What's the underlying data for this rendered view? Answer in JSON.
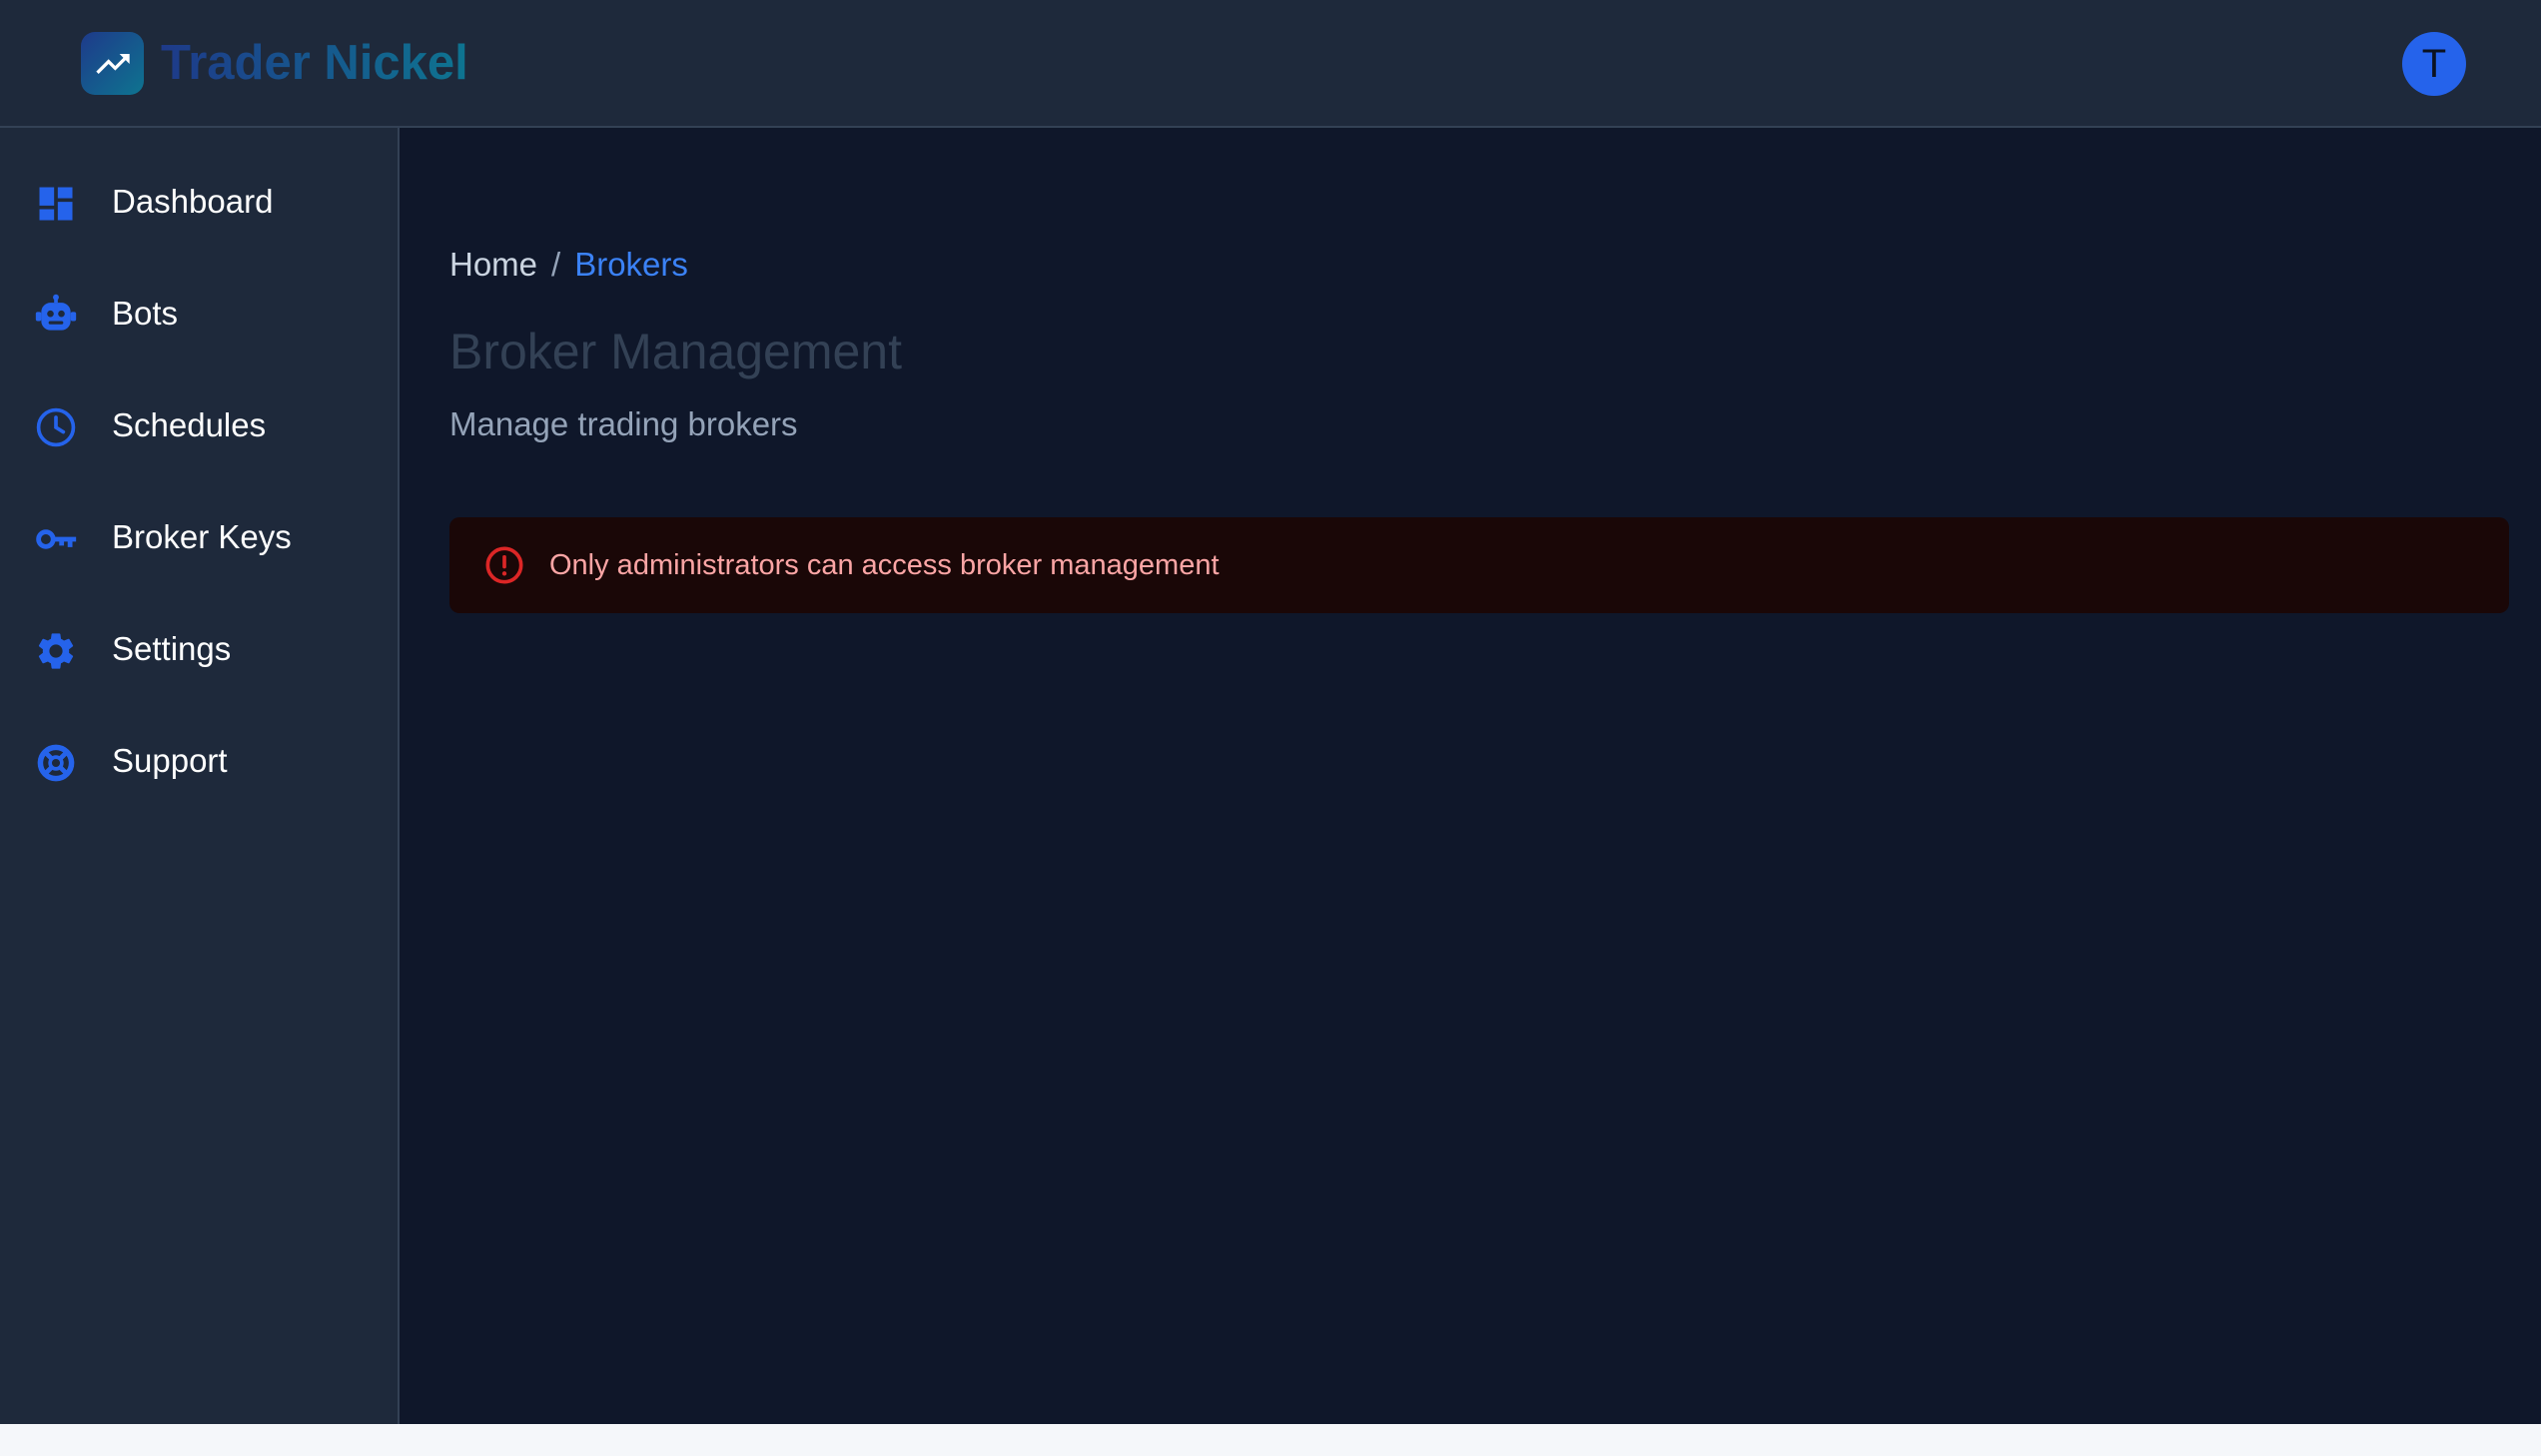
{
  "header": {
    "brand": "Trader Nickel",
    "avatar_initial": "T"
  },
  "sidebar": {
    "items": [
      {
        "label": "Dashboard",
        "icon": "dashboard-icon"
      },
      {
        "label": "Bots",
        "icon": "robot-icon"
      },
      {
        "label": "Schedules",
        "icon": "clock-icon"
      },
      {
        "label": "Broker Keys",
        "icon": "key-icon"
      },
      {
        "label": "Settings",
        "icon": "gear-icon"
      },
      {
        "label": "Support",
        "icon": "lifebuoy-icon"
      }
    ]
  },
  "breadcrumb": {
    "home": "Home",
    "separator": "/",
    "current": "Brokers"
  },
  "page": {
    "title": "Broker Management",
    "subtitle": "Manage trading brokers"
  },
  "alert": {
    "message": "Only administrators can access broker management",
    "icon": "alert-circle-icon"
  },
  "colors": {
    "accent": "#2563eb",
    "sidebar_bg": "#1e293b",
    "main_bg": "#0f172a",
    "error": "#dc2626"
  }
}
